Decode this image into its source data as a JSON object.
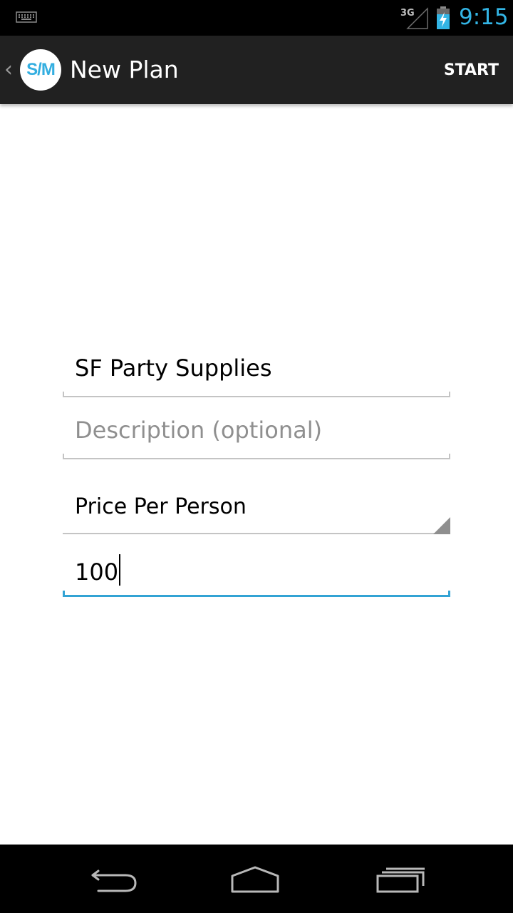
{
  "status_bar": {
    "network": "3G",
    "time": "9:15",
    "icons": [
      "keyboard-icon",
      "signal-icon",
      "battery-charging-icon"
    ]
  },
  "action_bar": {
    "logo_text": "S/M",
    "title": "New Plan",
    "action_label": "START"
  },
  "form": {
    "name_value": "SF Party Supplies",
    "description_placeholder": "Description (optional)",
    "description_value": "",
    "pricing_selected": "Price Per Person",
    "amount_value": "100"
  },
  "nav_bar": {
    "icons": [
      "back-icon",
      "home-icon",
      "recent-apps-icon"
    ]
  },
  "colors": {
    "accent": "#33b5e5",
    "action_bar_bg": "#212121",
    "focus_underline": "#33a3d4"
  }
}
